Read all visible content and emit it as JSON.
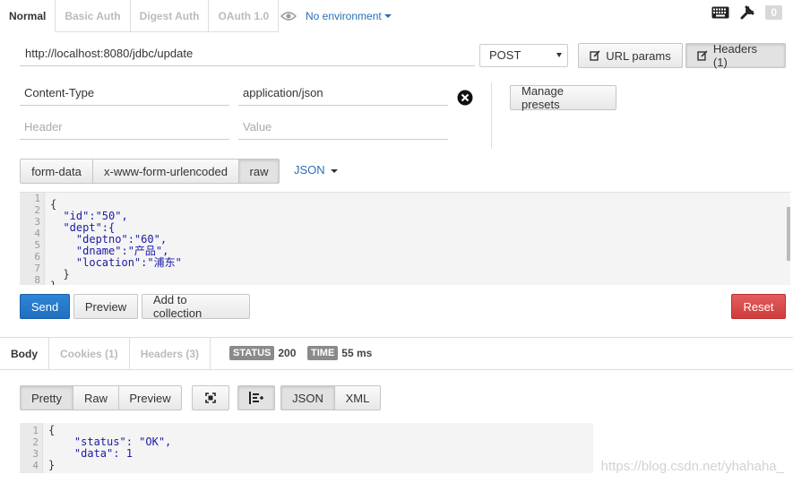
{
  "auth_tabs": [
    "Normal",
    "Basic Auth",
    "Digest Auth",
    "OAuth 1.0"
  ],
  "environment": {
    "label": "No environment"
  },
  "top_right": {
    "badge": "0"
  },
  "request": {
    "url": "http://localhost:8080/jdbc/update",
    "method": "POST",
    "url_params_label": "URL params",
    "headers_label": "Headers (1)"
  },
  "headers": {
    "rows": [
      {
        "key": "Content-Type",
        "value": "application/json"
      }
    ],
    "key_placeholder": "Header",
    "value_placeholder": "Value",
    "manage_presets_label": "Manage presets"
  },
  "body_types": [
    "form-data",
    "x-www-form-urlencoded",
    "raw"
  ],
  "raw_type": "JSON",
  "editor": {
    "line_numbers": [
      "1",
      "2",
      "3",
      "4",
      "5",
      "6",
      "7",
      "8"
    ],
    "lines": [
      "{",
      "  \"id\":\"50\",",
      "  \"dept\":{",
      "    \"deptno\":\"60\",",
      "    \"dname\":\"产品\",",
      "    \"location\":\"浦东\"",
      "  }",
      "}"
    ]
  },
  "actions": {
    "send": "Send",
    "preview": "Preview",
    "add_to_collection": "Add to collection",
    "reset": "Reset"
  },
  "response": {
    "tabs": [
      "Body",
      "Cookies (1)",
      "Headers (3)"
    ],
    "status_label": "STATUS",
    "status_value": "200",
    "time_label": "TIME",
    "time_value": "55 ms",
    "view_modes": [
      "Pretty",
      "Raw",
      "Preview"
    ],
    "formats": [
      "JSON",
      "XML"
    ],
    "line_numbers": [
      "1",
      "2",
      "3",
      "4"
    ],
    "lines": [
      "{",
      "    \"status\": \"OK\",",
      "    \"data\": 1",
      "}"
    ]
  },
  "watermark": "https://blog.csdn.net/yhahaha_"
}
